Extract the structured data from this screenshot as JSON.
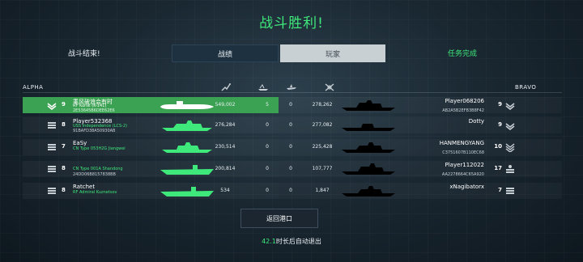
{
  "title": "战斗胜利!",
  "battle_end": "战斗结束!",
  "tabs": [
    {
      "label": "战绩",
      "active": true
    },
    {
      "label": "玩家",
      "active": false
    }
  ],
  "mission_done": "任务完成",
  "teams": {
    "alpha": "ALPHA",
    "bravo": "BRAVO"
  },
  "stat_icons": [
    "damage-icon",
    "ship-kills-icon",
    "aircraft-kills-icon",
    "score-icon"
  ],
  "alpha_players": [
    {
      "rank": "9",
      "name": "乘风破浪会有时",
      "ship": "RF Kursk (K-141)",
      "id": "2E53645B6DEE62E6",
      "damage": "549,002",
      "kills": "5",
      "air": "0",
      "score": "278,262",
      "highlight": true
    },
    {
      "rank": "8",
      "name": "Player532368",
      "ship": "USS Independence (LCS-2)",
      "id": "91BAFD38A50930AB",
      "damage": "276,284",
      "kills": "0",
      "air": "0",
      "score": "277,082",
      "highlight": false
    },
    {
      "rank": "7",
      "name": "EaSy",
      "ship": "CN Type 053H2G Jiangwei",
      "id": "",
      "damage": "230,514",
      "kills": "0",
      "air": "0",
      "score": "225,428",
      "highlight": false
    },
    {
      "rank": "8",
      "name": "",
      "ship": "CN Type 001A Shandong",
      "id": "24DD06B8157838BB",
      "damage": "200,814",
      "kills": "0",
      "air": "0",
      "score": "107,777",
      "highlight": false
    },
    {
      "rank": "8",
      "name": "Ratchet",
      "ship": "RF Admiral Kuznetsov",
      "id": "",
      "damage": "534",
      "kills": "0",
      "air": "0",
      "score": "1,847",
      "highlight": false
    }
  ],
  "bravo_players": [
    {
      "name": "Player068206",
      "id": "AB2A5B2EFB3B8F42",
      "rank": "9"
    },
    {
      "name": "Dotty",
      "id": "",
      "rank": "9"
    },
    {
      "name": "HANMENGYANG",
      "id": "C3751607B110EC68",
      "rank": "10"
    },
    {
      "name": "Player112022",
      "id": "AA2278664C65A920",
      "rank": "17"
    },
    {
      "name": "xNagibatorx",
      "id": "",
      "rank": "7"
    }
  ],
  "return_button": "返回港口",
  "auto_exit": {
    "count": "42.1",
    "text": "时长后自动退出"
  },
  "colors": {
    "accent_green": "#3ee87a",
    "highlight_row": "#3ca253",
    "background": "#1a2832"
  }
}
